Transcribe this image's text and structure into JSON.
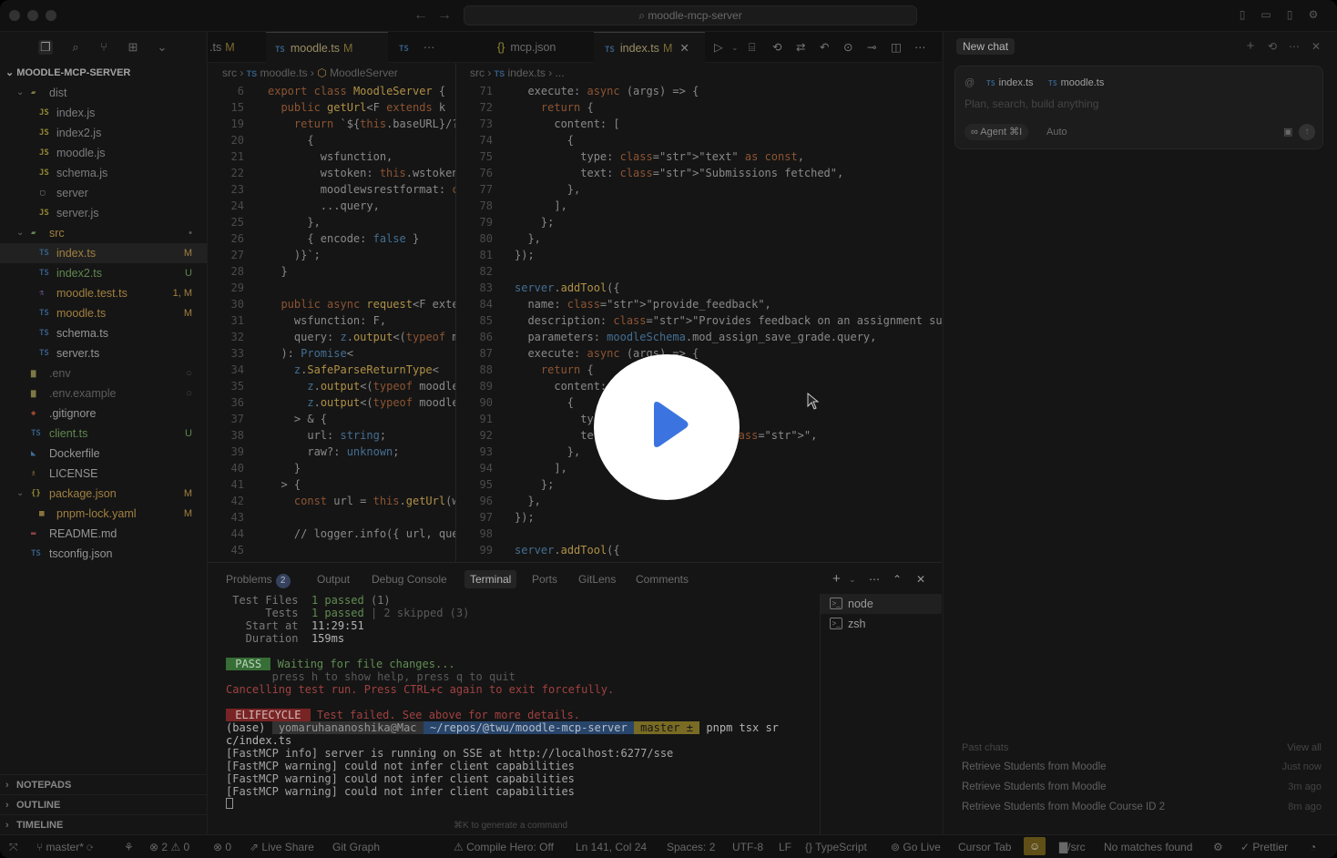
{
  "titlebar": {
    "search": "moodle-mcp-server"
  },
  "explorer": {
    "title": "MOODLE-MCP-SERVER",
    "dist": {
      "label": "dist",
      "files": [
        "index.js",
        "index2.js",
        "moodle.js",
        "schema.js",
        "server",
        "server.js"
      ]
    },
    "src": {
      "label": "src",
      "files": [
        {
          "name": "index.ts",
          "badge": "M"
        },
        {
          "name": "index2.ts",
          "badge": "U"
        },
        {
          "name": "moodle.test.ts",
          "badge": "1, M"
        },
        {
          "name": "moodle.ts",
          "badge": "M"
        },
        {
          "name": "schema.ts",
          "badge": ""
        },
        {
          "name": "server.ts",
          "badge": ""
        }
      ]
    },
    "root_files": [
      {
        "name": ".env",
        "badge": ""
      },
      {
        "name": ".env.example",
        "badge": ""
      },
      {
        "name": ".gitignore",
        "badge": ""
      },
      {
        "name": "client.ts",
        "badge": "U"
      },
      {
        "name": "Dockerfile",
        "badge": ""
      },
      {
        "name": "LICENSE",
        "badge": ""
      },
      {
        "name": "package.json",
        "badge": "M"
      },
      {
        "name": "pnpm-lock.yaml",
        "badge": "M"
      },
      {
        "name": "README.md",
        "badge": ""
      },
      {
        "name": "tsconfig.json",
        "badge": ""
      }
    ],
    "sections": [
      "NOTEPADS",
      "OUTLINE",
      "TIMELINE"
    ]
  },
  "tabs": {
    "left": [
      {
        "label": ".ts",
        "mod": "M"
      },
      {
        "label": "moodle.ts",
        "mod": "M"
      },
      {
        "label": "TS",
        "mod": ""
      }
    ],
    "right": [
      {
        "label": "mcp.json",
        "mod": ""
      },
      {
        "label": "index.ts",
        "mod": "M"
      }
    ]
  },
  "breadcrumbs": {
    "left": [
      "src",
      "moodle.ts",
      "MoodleServer"
    ],
    "right": [
      "src",
      "index.ts",
      "..."
    ]
  },
  "editor_left": {
    "line_numbers": [
      "6",
      "15",
      "19",
      "20",
      "21",
      "22",
      "23",
      "24",
      "25",
      "26",
      "27",
      "28",
      "29",
      "30",
      "31",
      "32",
      "33",
      "34",
      "35",
      "36",
      "37",
      "38",
      "39",
      "40",
      "41",
      "42",
      "43",
      "44",
      "45"
    ],
    "lines": [
      "export class MoodleServer {",
      "  public getUrl<F extends k",
      "    return `${this.baseURL}/?",
      "      {",
      "        wsfunction,",
      "        wstoken: this.wstoken",
      "        moodlewsrestformat: \"",
      "        ...query,",
      "      },",
      "      { encode: false }",
      "    )}`;",
      "  }",
      "",
      "  public async request<F exte",
      "    wsfunction: F,",
      "    query: z.output<(typeof m",
      "  ): Promise<",
      "    z.SafeParseReturnType<",
      "      z.output<(typeof moodle",
      "      z.output<(typeof moodle",
      "    > & {",
      "      url: string;",
      "      raw?: unknown;",
      "    }",
      "  > {",
      "    const url = this.getUrl(w",
      "",
      "    // logger.info({ url, que",
      ""
    ]
  },
  "editor_right": {
    "line_numbers": [
      "71",
      "72",
      "73",
      "74",
      "75",
      "76",
      "77",
      "78",
      "79",
      "80",
      "81",
      "82",
      "83",
      "84",
      "85",
      "86",
      "87",
      "88",
      "89",
      "90",
      "91",
      "92",
      "93",
      "94",
      "95",
      "96",
      "97",
      "98",
      "99"
    ],
    "lines": [
      "  execute: async (args) => {",
      "    return {",
      "      content: [",
      "        {",
      "          type: \"text\" as const,",
      "          text: \"Submissions fetched\",",
      "        },",
      "      ],",
      "    };",
      "  },",
      "});",
      "",
      "server.addTool({",
      "  name: \"provide_feedback\",",
      "  description: \"Provides feedback on an assignment submitted by a",
      "  parameters: moodleSchema.mod_assign_save_grade.query,",
      "  execute: async (args) => {",
      "    return {",
      "      content:",
      "        {",
      "          ty",
      "          te                    \",",
      "        },",
      "      ],",
      "    };",
      "  },",
      "});",
      "",
      "server.addTool({"
    ]
  },
  "panel": {
    "tabs": [
      "Problems",
      "Output",
      "Debug Console",
      "Terminal",
      "Ports",
      "GitLens",
      "Comments"
    ],
    "problems_count": "2",
    "terminals": [
      "node",
      "zsh"
    ],
    "hint": "⌘K to generate a command",
    "terminal_lines": {
      "test_files_label": " Test Files",
      "test_files_val": "1 passed",
      "test_files_rest": " (1)",
      "tests_label": "      Tests",
      "tests_val": "1 passed",
      "tests_rest": " | 2 skipped (3)",
      "start_label": "   Start at",
      "start_val": "11:29:51",
      "duration_label": "   Duration",
      "duration_val": "159ms",
      "pass_badge": " PASS ",
      "pass_msg": " Waiting for file changes...",
      "press_line": "       press h to show help, press q to quit",
      "cancel_line": "Cancelling test run. Press CTRL+c again to exit forcefully.",
      "fail_badge": " ELIFECYCLE ",
      "fail_msg": " Test failed. See above for more details.",
      "prompt_base": "(base)",
      "prompt_user": " yomaruhananoshika@Mac ",
      "prompt_path": " ~/repos/@twu/moodle-mcp-server ",
      "prompt_branch": " master ± ",
      "prompt_cmd": " pnpm tsx sr",
      "prompt_cmd2": "c/index.ts",
      "log1": "[FastMCP info] server is running on SSE at http://localhost:6277/sse",
      "log2": "[FastMCP warning] could not infer client capabilities",
      "log3": "[FastMCP warning] could not infer client capabilities",
      "log4": "[FastMCP warning] could not infer client capabilities"
    }
  },
  "chat": {
    "tab": "New chat",
    "context_files": [
      "index.ts",
      "moodle.ts"
    ],
    "placeholder": "Plan, search, build anything",
    "agent": "∞ Agent ⌘I",
    "auto": "Auto",
    "past_title": "Past chats",
    "view_all": "View all",
    "past": [
      {
        "title": "Retrieve Students from Moodle",
        "when": "Just now"
      },
      {
        "title": "Retrieve Students from Moodle",
        "when": "3m ago"
      },
      {
        "title": "Retrieve Students from Moodle Course ID 2",
        "when": "8m ago"
      }
    ]
  },
  "statusbar": {
    "branch": "master*",
    "problems": "⊗ 2 ⚠ 0",
    "ports": "0",
    "live_share": "Live Share",
    "git_graph": "Git Graph",
    "compile_hero": "Compile Hero: Off",
    "position": "Ln 141, Col 24",
    "spaces": "Spaces: 2",
    "encoding": "UTF-8",
    "eol": "LF",
    "language": "TypeScript",
    "go_live": "Go Live",
    "cursor_tab": "Cursor Tab",
    "folder": "/src",
    "matches": "No matches found",
    "prettier": "Prettier"
  }
}
